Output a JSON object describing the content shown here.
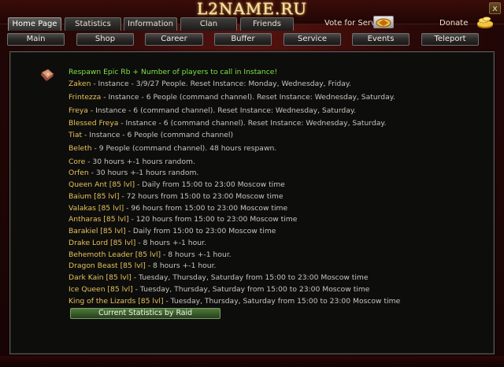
{
  "logo": "L2NAME.RU",
  "close_label": "x",
  "top_tabs": [
    {
      "label": "Home Page",
      "active": true
    },
    {
      "label": "Statistics",
      "active": false
    },
    {
      "label": "Information",
      "active": false
    },
    {
      "label": "Clan",
      "active": false
    },
    {
      "label": "Friends",
      "active": false
    }
  ],
  "vote_label": "Vote for Server",
  "donate_label": "Donate",
  "sub_buttons": [
    "Main",
    "Shop",
    "Career",
    "Buffer",
    "Service",
    "Events",
    "Teleport"
  ],
  "heading": "Respawn Epic Rb + Number of players to call in Instance!",
  "entries": [
    {
      "name": "Zaken",
      "desc": " - Instance - 3/9/27 People. Reset Instance: Monday, Wednesday, Friday."
    },
    {
      "name": "Frintezza",
      "desc": " - Instance - 6 People  (command channel). Reset Instance: Wednesday, Saturday."
    },
    {
      "name": "Freya",
      "desc": " - Instance - 6  (command channel). Reset Instance: Wednesday, Saturday."
    },
    {
      "name": "Blessed Freya",
      "desc": " - Instance - 6 (command channel). Reset Instance: Wednesday, Saturday."
    },
    {
      "name": "Tiat",
      "desc": " - Instance - 6 People (command channel)"
    },
    {
      "name": "Beleth",
      "desc": " - 9 People (command channel). 48 hours respawn."
    },
    {
      "name": "Core",
      "desc": " - 30 hours +-1 hours random."
    },
    {
      "name": "Orfen",
      "desc": " - 30 hours +-1 hours random."
    },
    {
      "name": "Queen Ant [85 lvl]",
      "desc": " - Daily from 15:00 to 23:00 Moscow time"
    },
    {
      "name": "Baium [85 lvl]",
      "desc": " - 72 hours from 15:00 to 23:00 Moscow time"
    },
    {
      "name": "Valakas [85 lvl]",
      "desc": " - 96 hours from 15:00 to 23:00 Moscow time"
    },
    {
      "name": "Antharas [85 lvl]",
      "desc": " - 120 hours from 15:00 to 23:00 Moscow time"
    },
    {
      "name": "Barakiel [85 lvl]",
      "desc": " - Daily from 15:00 to 23:00 Moscow time"
    },
    {
      "name": "Drake Lord [85 lvl]",
      "desc": " - 8 hours +-1 hour."
    },
    {
      "name": "Behemoth Leader [85 lvl]",
      "desc": " - 8 hours +-1 hour."
    },
    {
      "name": "Dragon Beast [85 lvl]",
      "desc": " - 8 hours +-1 hour."
    },
    {
      "name": "Dark Kain [85 lvl]",
      "desc": " - Tuesday, Thursday, Saturday from 15:00 to 23:00 Moscow time"
    },
    {
      "name": "Ice Queen [85 lvl]",
      "desc": " - Tuesday, Thursday, Saturday from 15:00 to 23:00 Moscow time"
    },
    {
      "name": "King of the Lizards [85 lvl]",
      "desc": " - Tuesday, Thursday, Saturday from 15:00 to 23:00 Moscow time"
    }
  ],
  "raid_button": "Current Statistics by Raid",
  "colors": {
    "name": "#e8c15a",
    "heading": "#7fe048",
    "desc": "#c8c4ba"
  }
}
